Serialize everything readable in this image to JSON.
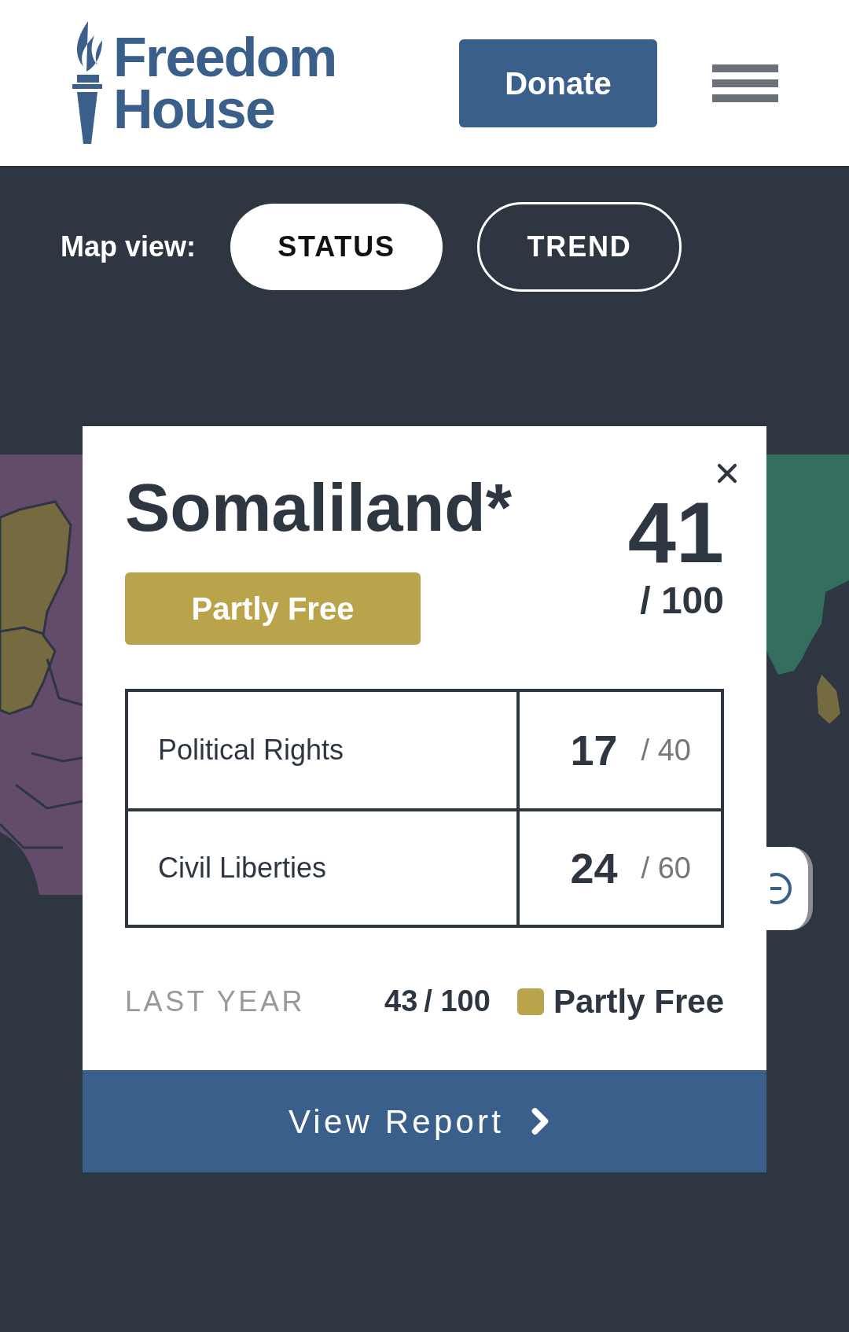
{
  "header": {
    "logo_lines": [
      "Freedom",
      "House"
    ],
    "donate": "Donate"
  },
  "map_view": {
    "label": "Map view:",
    "tabs": [
      {
        "label": "STATUS",
        "selected": true
      },
      {
        "label": "TREND",
        "selected": false
      }
    ]
  },
  "card": {
    "title": "Somaliland*",
    "status": {
      "label": "Partly Free",
      "color": "#b9a34b"
    },
    "score": "41",
    "score_max": "/ 100",
    "rows": [
      {
        "label": "Political Rights",
        "score": "17",
        "max": "/ 40"
      },
      {
        "label": "Civil Liberties",
        "score": "24",
        "max": "/ 60"
      }
    ],
    "last_year": {
      "label": "LAST YEAR",
      "score": "43",
      "max": "/ 100",
      "status": "Partly Free",
      "color": "#b9a34b"
    },
    "view_report": "View Report"
  }
}
